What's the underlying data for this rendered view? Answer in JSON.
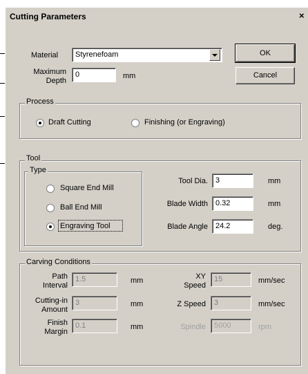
{
  "window": {
    "title": "Cutting Parameters",
    "close": "×"
  },
  "material": {
    "label": "Material",
    "value": "Styrenefoam"
  },
  "max_depth": {
    "label_line1": "Maximum",
    "label_line2": "Depth",
    "value": "0",
    "unit": "mm"
  },
  "buttons": {
    "ok": "OK",
    "cancel": "Cancel"
  },
  "process": {
    "legend": "Process",
    "options": [
      "Draft Cutting",
      "Finishing (or Engraving)"
    ],
    "selected": "Draft Cutting"
  },
  "tool": {
    "legend": "Tool",
    "type_legend": "Type",
    "types": [
      "Square End Mill",
      "Ball End Mill",
      "Engraving Tool"
    ],
    "selected": "Engraving Tool",
    "dia": {
      "label": "Tool Dia.",
      "value": "3",
      "unit": "mm"
    },
    "blade_width": {
      "label": "Blade Width",
      "value": "0.32",
      "unit": "mm"
    },
    "blade_angle": {
      "label": "Blade Angle",
      "value": "24.2",
      "unit": "deg."
    }
  },
  "carving": {
    "legend": "Carving Conditions",
    "path_interval": {
      "label_line1": "Path",
      "label_line2": "Interval",
      "value": "1.5",
      "unit": "mm"
    },
    "cutting_in": {
      "label_line1": "Cutting-in",
      "label_line2": "Amount",
      "value": "3",
      "unit": "mm"
    },
    "finish_margin": {
      "label_line1": "Finish",
      "label_line2": "Margin",
      "value": "0.1",
      "unit": "mm"
    },
    "xy_speed": {
      "label_line1": "XY",
      "label_line2": "Speed",
      "value": "15",
      "unit": "mm/sec"
    },
    "z_speed": {
      "label": "Z Speed",
      "value": "3",
      "unit": "mm/sec"
    },
    "spindle": {
      "label": "Spindle",
      "value": "5000",
      "unit": "rpm"
    }
  }
}
